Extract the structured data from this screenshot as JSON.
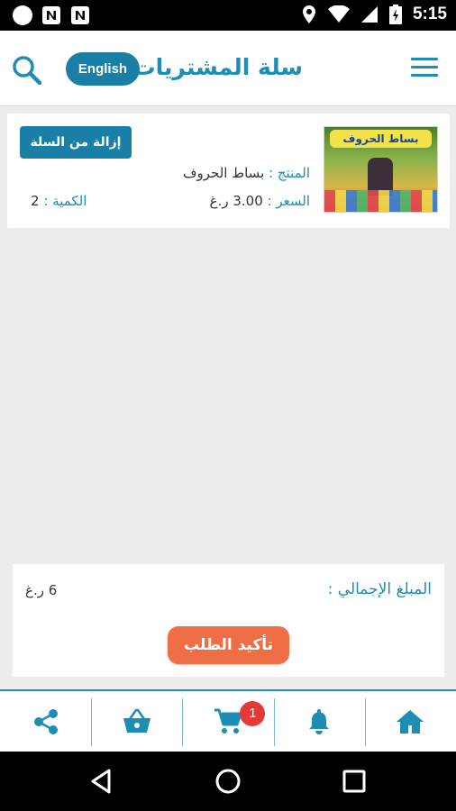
{
  "status_bar": {
    "time": "5:15"
  },
  "header": {
    "title": "سلة المشتريات",
    "language_button": "English"
  },
  "cart_item": {
    "thumbnail_text": "بساط الحروف",
    "remove_button": "إزالة من السلة",
    "product_label": "المنتج :",
    "product_name": "بساط الحروف",
    "price_label": "السعر :",
    "price_value": "3.00 ر.غ",
    "quantity_label": "الكمية :",
    "quantity_value": "2"
  },
  "summary": {
    "total_label": "المبلغ الإجمالي :",
    "total_value": "6 ر.غ",
    "confirm_button": "تأكيد الطلب"
  },
  "bottom_nav": {
    "cart_badge": "1",
    "items": [
      "share-icon",
      "basket-icon",
      "cart-icon",
      "bell-icon",
      "home-icon"
    ]
  },
  "colors": {
    "accent": "#1e8db3",
    "button": "#1a7fa6",
    "confirm": "#ef6e45",
    "badge": "#e53935"
  }
}
